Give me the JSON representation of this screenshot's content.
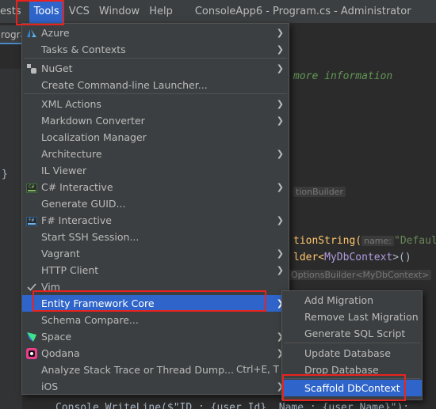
{
  "menubar": {
    "items": [
      "ests",
      "Tools",
      "VCS",
      "Window",
      "Help"
    ],
    "title": "ConsoleApp6 - Program.cs - Administrator"
  },
  "tab": {
    "label": "rogra"
  },
  "editor": {
    "lines": [
      {
        "text": "more information"
      },
      {
        "text": "tionBuilder"
      },
      {
        "pre": "tionString(",
        "hint": "name:",
        "str": "\"DefaultCo"
      },
      {
        "pre": "lder<",
        "type": "MyDbContext",
        "post": ">()"
      },
      {
        "hint": "OptionsBuilder<MyDbContext>"
      },
      {
        "text": "Console.WriteLine($\"ID : {user.Id}, Name : {user.Name}\");"
      }
    ]
  },
  "tools_menu": {
    "items": [
      {
        "label": "Azure",
        "icon": "azure-icon",
        "submenu": true
      },
      {
        "label": "Tasks & Contexts",
        "submenu": true
      },
      {
        "label": "NuGet",
        "icon": "nuget-icon",
        "submenu": true
      },
      {
        "label": "Create Command-line Launcher...",
        "submenu": false
      },
      {
        "label": "XML Actions",
        "submenu": true
      },
      {
        "label": "Markdown Converter",
        "submenu": true
      },
      {
        "label": "Localization Manager",
        "submenu": false
      },
      {
        "label": "Architecture",
        "submenu": true
      },
      {
        "label": "IL Viewer",
        "submenu": false
      },
      {
        "label": "C# Interactive",
        "icon": "csharp-interactive-icon",
        "submenu": true
      },
      {
        "label": "Generate GUID...",
        "submenu": false
      },
      {
        "label": "F# Interactive",
        "icon": "fsharp-interactive-icon",
        "submenu": true
      },
      {
        "label": "Start SSH Session...",
        "submenu": false
      },
      {
        "label": "Vagrant",
        "submenu": true
      },
      {
        "label": "HTTP Client",
        "submenu": true
      },
      {
        "label": "Vim",
        "icon": "check-icon",
        "submenu": false
      },
      {
        "label": "Entity Framework Core",
        "submenu": true,
        "selected": true
      },
      {
        "label": "Schema Compare...",
        "submenu": false
      },
      {
        "label": "Space",
        "icon": "space-icon",
        "submenu": true
      },
      {
        "label": "Qodana",
        "icon": "qodana-icon",
        "submenu": true
      },
      {
        "label": "Analyze Stack Trace or Thread Dump...",
        "shortcut": "Ctrl+E, T",
        "submenu": false
      },
      {
        "label": "iOS",
        "submenu": true
      }
    ]
  },
  "ef_submenu": {
    "items": [
      {
        "label": "Add Migration"
      },
      {
        "label": "Remove Last Migration"
      },
      {
        "label": "Generate SQL Script"
      },
      {
        "label": "Update Database"
      },
      {
        "label": "Drop Database"
      },
      {
        "label": "Scaffold DbContext",
        "selected": true
      }
    ]
  },
  "colors": {
    "selection": "#2f65ca",
    "menu_bg": "#3c3f41",
    "annotation": "#e8231f"
  }
}
